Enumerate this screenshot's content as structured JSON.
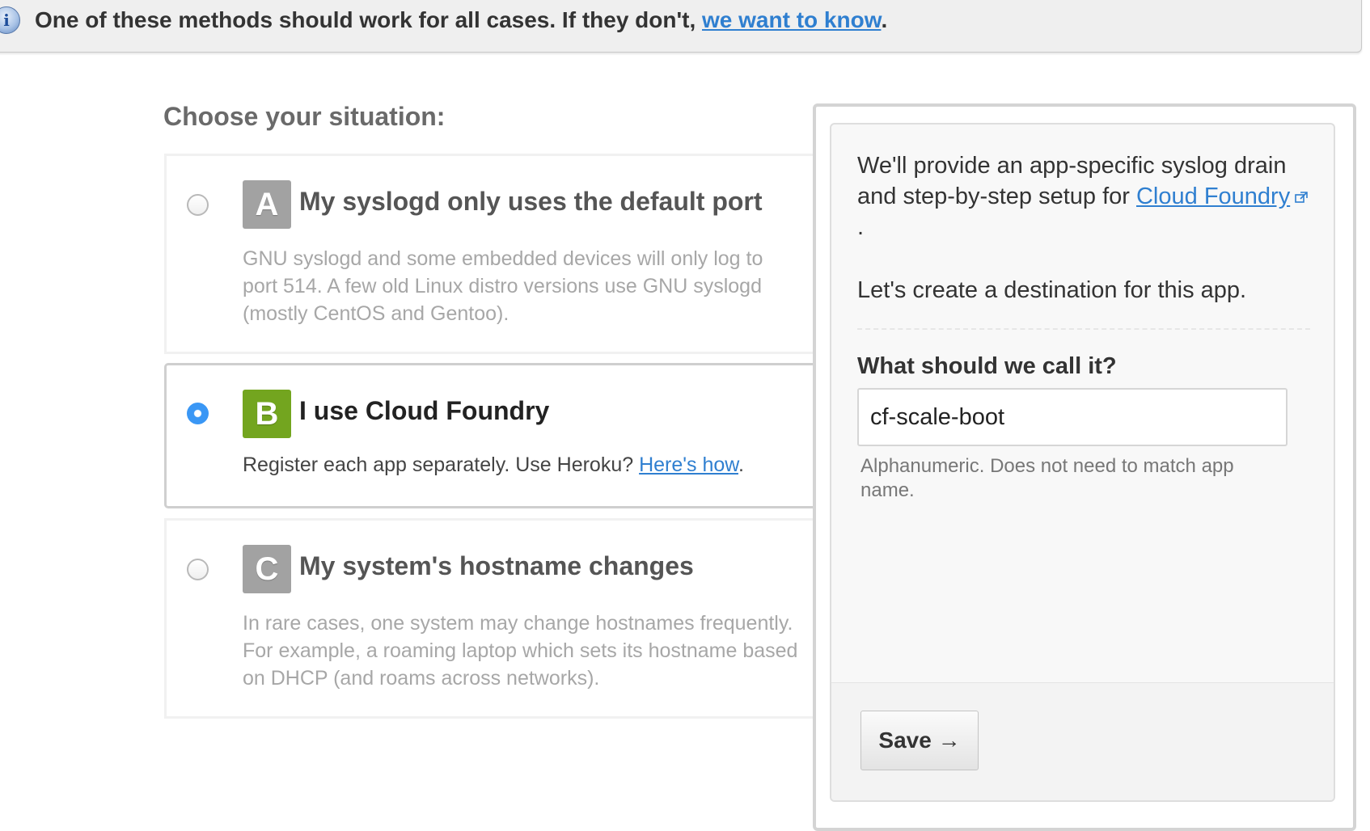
{
  "banner": {
    "icon": "info-icon",
    "icon_glyph": "i",
    "text": "One of these methods should work for all cases. If they don't, ",
    "link": "we want to know",
    "suffix": "."
  },
  "chooser": {
    "heading": "Choose your situation:",
    "selected": "B",
    "options": [
      {
        "letter": "A",
        "title": "My syslogd only uses the default port",
        "description": "GNU syslogd and some embedded devices will only log to port 514. A few old Linux distro versions use GNU syslogd (mostly CentOS and Gentoo)."
      },
      {
        "letter": "B",
        "title": "I use Cloud Foundry",
        "description": "Register each app separately. Use Heroku? ",
        "link": "Here's how",
        "suffix": "."
      },
      {
        "letter": "C",
        "title": "My system's hostname changes",
        "description": "In rare cases, one system may change hostnames frequently. For example, a roaming laptop which sets its hostname based on DHCP (and roams across networks)."
      }
    ],
    "colors": {
      "selected_badge": "#73a51f",
      "unselected_badge": "#a2a2a2",
      "radio_checked": "#3a97f5",
      "link": "#2f7fd0"
    }
  },
  "panel": {
    "intro": "We'll provide an app-specific syslog drain and step-by-step setup for ",
    "intro_link": "Cloud Foundry",
    "intro_link_icon": "external-link-icon",
    "intro_suffix": " .",
    "create": "Let's create a destination for this app.",
    "name_label": "What should we call it?",
    "name_value": "cf-scale-boot",
    "name_hint": "Alphanumeric. Does not need to match app name.",
    "save_label": "Save →"
  }
}
